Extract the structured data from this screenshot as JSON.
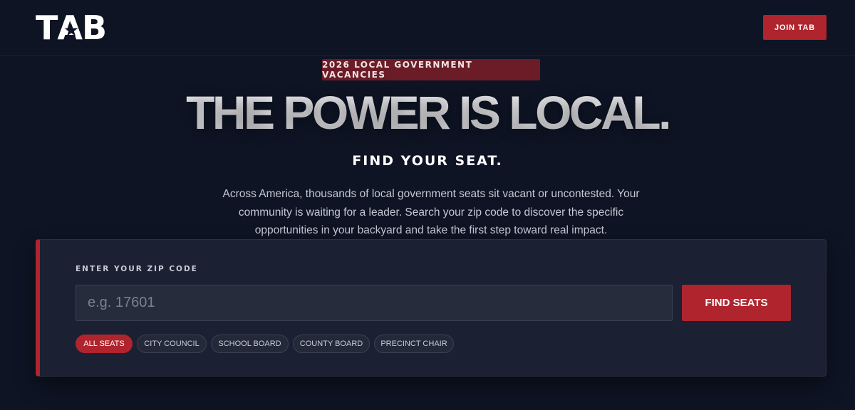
{
  "header": {
    "logo_text": "TAB",
    "join_label": "JOIN TAB"
  },
  "hero": {
    "badge": "2026 LOCAL GOVERNMENT VACANCIES",
    "headline": "THE POWER IS LOCAL.",
    "subhead": "FIND YOUR SEAT.",
    "intro": "Across America, thousands of local government seats sit vacant or uncontested. Your community is waiting for a leader. Search your zip code to discover the specific opportunities in your backyard and take the first step toward real impact."
  },
  "search": {
    "label": "ENTER YOUR ZIP CODE",
    "placeholder": "e.g. 17601",
    "value": "",
    "button_label": "FIND SEATS"
  },
  "filters": [
    {
      "label": "ALL SEATS",
      "active": true
    },
    {
      "label": "CITY COUNCIL",
      "active": false
    },
    {
      "label": "SCHOOL BOARD",
      "active": false
    },
    {
      "label": "COUNTY BOARD",
      "active": false
    },
    {
      "label": "PRECINCT CHAIR",
      "active": false
    }
  ],
  "colors": {
    "background": "#0e1424",
    "accent": "#b0242e",
    "badge": "#6b1c27",
    "panel": "#1b2132"
  },
  "icons": {
    "logo_star": "star-icon"
  }
}
